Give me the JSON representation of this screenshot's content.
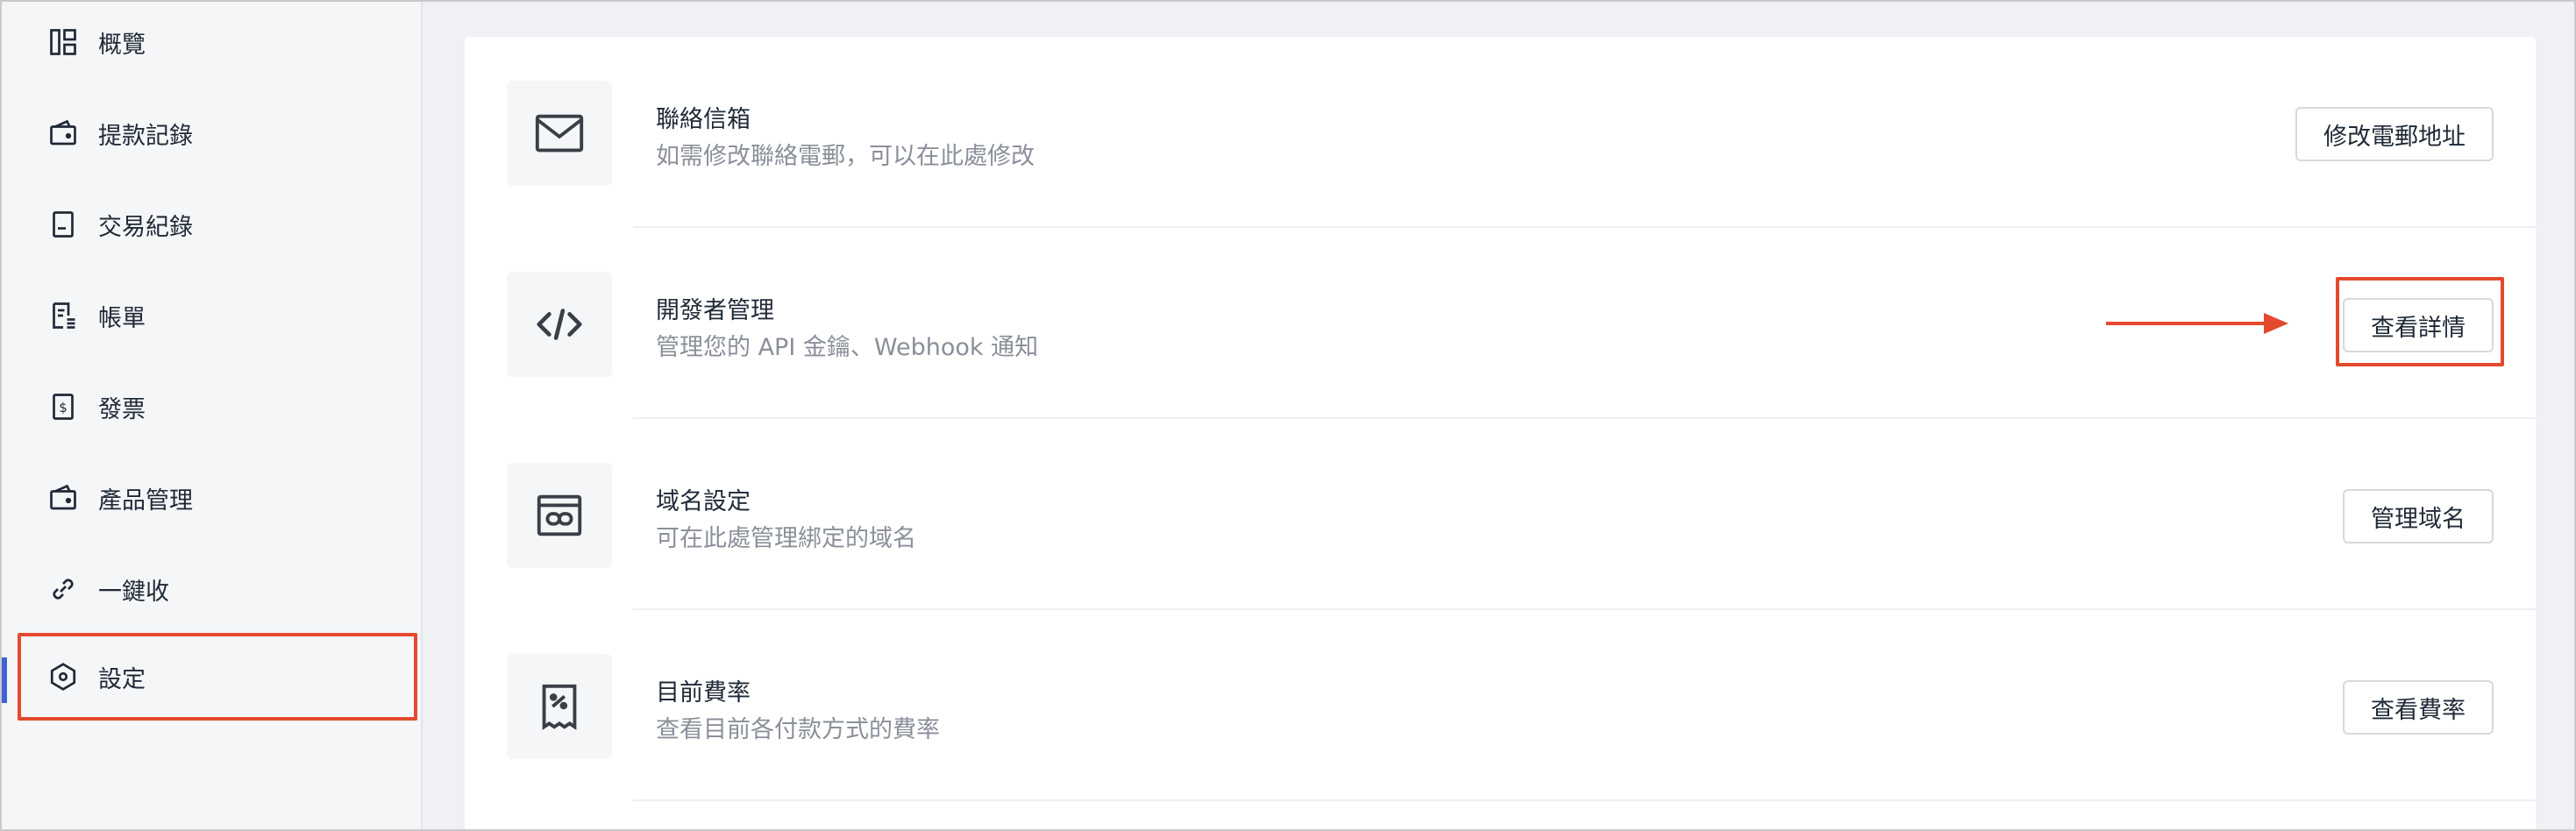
{
  "sidebar": {
    "items": [
      {
        "label": "概覽",
        "icon": "dashboard-icon"
      },
      {
        "label": "提款記錄",
        "icon": "wallet-icon"
      },
      {
        "label": "交易紀錄",
        "icon": "document-icon"
      },
      {
        "label": "帳單",
        "icon": "bill-icon"
      },
      {
        "label": "發票",
        "icon": "invoice-icon"
      },
      {
        "label": "產品管理",
        "icon": "product-wallet-icon"
      },
      {
        "label": "一鍵收",
        "icon": "link-icon"
      },
      {
        "label": "設定",
        "icon": "settings-hex-icon",
        "active": true
      }
    ]
  },
  "settings": {
    "rows": [
      {
        "title": "聯絡信箱",
        "desc": "如需修改聯絡電郵，可以在此處修改",
        "button": "修改電郵地址",
        "icon": "mail-icon"
      },
      {
        "title": "開發者管理",
        "desc": "管理您的 API 金鑰、Webhook 通知",
        "button": "查看詳情",
        "icon": "code-icon"
      },
      {
        "title": "域名設定",
        "desc": "可在此處管理綁定的域名",
        "button": "管理域名",
        "icon": "domain-link-icon"
      },
      {
        "title": "目前費率",
        "desc": "查看目前各付款方式的費率",
        "button": "查看費率",
        "icon": "receipt-percent-icon"
      }
    ]
  },
  "colors": {
    "highlight": "#e4492e",
    "active_indicator": "#3f63d6"
  }
}
